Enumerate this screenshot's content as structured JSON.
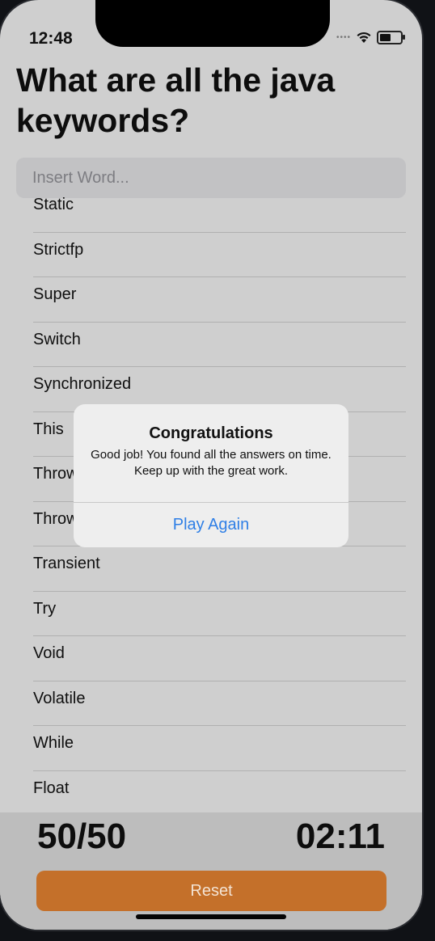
{
  "status": {
    "time": "12:48"
  },
  "title": "What are all the java keywords?",
  "search": {
    "placeholder": "Insert Word..."
  },
  "words": [
    "Static",
    "Strictfp",
    "Super",
    "Switch",
    "Synchronized",
    "This",
    "Throw",
    "Throws",
    "Transient",
    "Try",
    "Void",
    "Volatile",
    "While",
    "Float"
  ],
  "footer": {
    "score": "50/50",
    "timer": "02:11",
    "reset_label": "Reset"
  },
  "alert": {
    "title": "Congratulations",
    "message": "Good job! You found all the answers on time. Keep up with the great work.",
    "button": "Play Again"
  },
  "colors": {
    "accent": "#2f7fe6",
    "reset": "#c4702a"
  }
}
